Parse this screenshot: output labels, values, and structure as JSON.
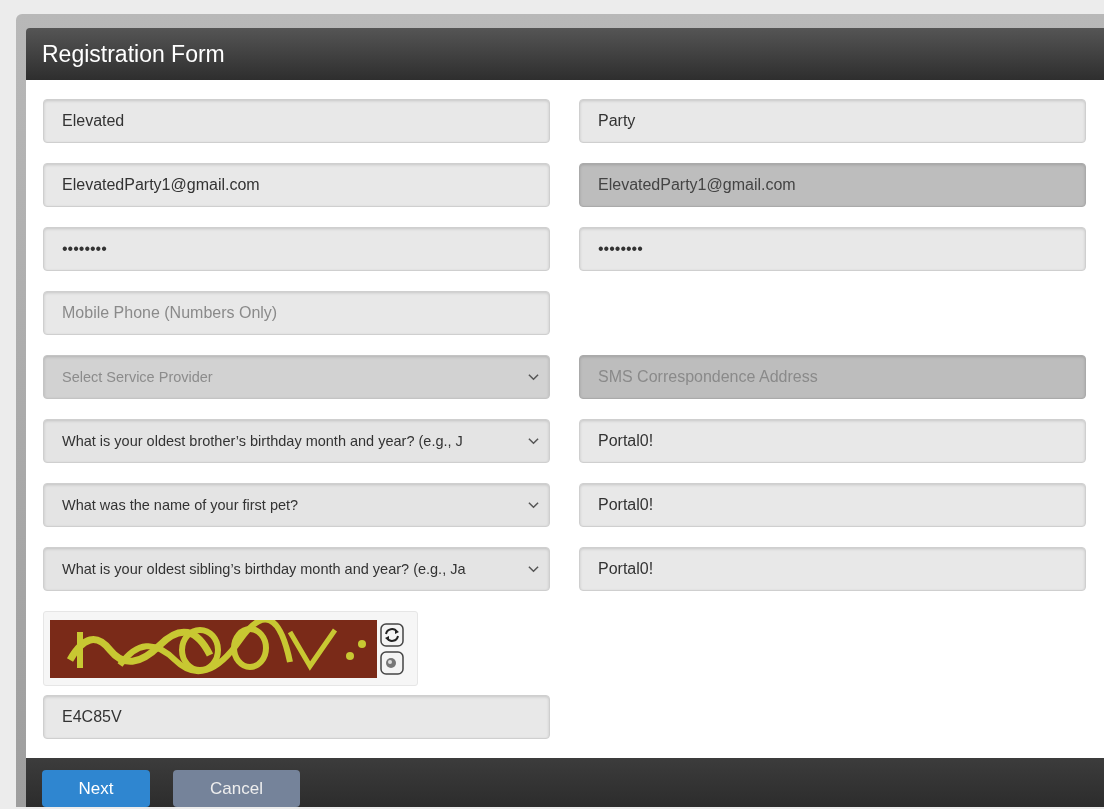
{
  "form": {
    "title": "Registration Form"
  },
  "rows": [
    [
      {
        "kind": "text",
        "value": "Elevated",
        "disabled": false
      },
      {
        "kind": "text",
        "value": "Party",
        "disabled": false
      }
    ],
    [
      {
        "kind": "text",
        "value": "ElevatedParty1@gmail.com",
        "disabled": false
      },
      {
        "kind": "text",
        "value": "ElevatedParty1@gmail.com",
        "disabled": true
      }
    ],
    [
      {
        "kind": "text",
        "value": "••••••••",
        "disabled": false
      },
      {
        "kind": "text",
        "value": "••••••••",
        "disabled": false
      }
    ],
    [
      {
        "kind": "text",
        "placeholder": "Mobile Phone (Numbers Only)",
        "disabled": false
      }
    ],
    [
      {
        "kind": "select",
        "placeholder": "Select Service Provider",
        "disabled": true
      },
      {
        "kind": "text",
        "placeholder": "SMS Correspondence Address",
        "disabled": true
      }
    ],
    [
      {
        "kind": "select",
        "value": "What is your oldest brother’s birthday month and year? (e.g., J",
        "disabled": false
      },
      {
        "kind": "text",
        "value": "Portal0!",
        "disabled": false
      }
    ],
    [
      {
        "kind": "select",
        "value": "What was the name of your first pet?",
        "disabled": false
      },
      {
        "kind": "text",
        "value": "Portal0!",
        "disabled": false
      }
    ],
    [
      {
        "kind": "select",
        "value": "What is your oldest sibling’s birthday month and year? (e.g., Ja",
        "disabled": false
      },
      {
        "kind": "text",
        "value": "Portal0!",
        "disabled": false
      }
    ]
  ],
  "captcha": {
    "kind": "picture",
    "answer": {
      "kind": "text",
      "value": "E4C85V",
      "disabled": false
    }
  },
  "buttons": [
    {
      "label": "Next",
      "kind": "primary"
    },
    {
      "label": "Cancel",
      "kind": "secondary"
    }
  ]
}
